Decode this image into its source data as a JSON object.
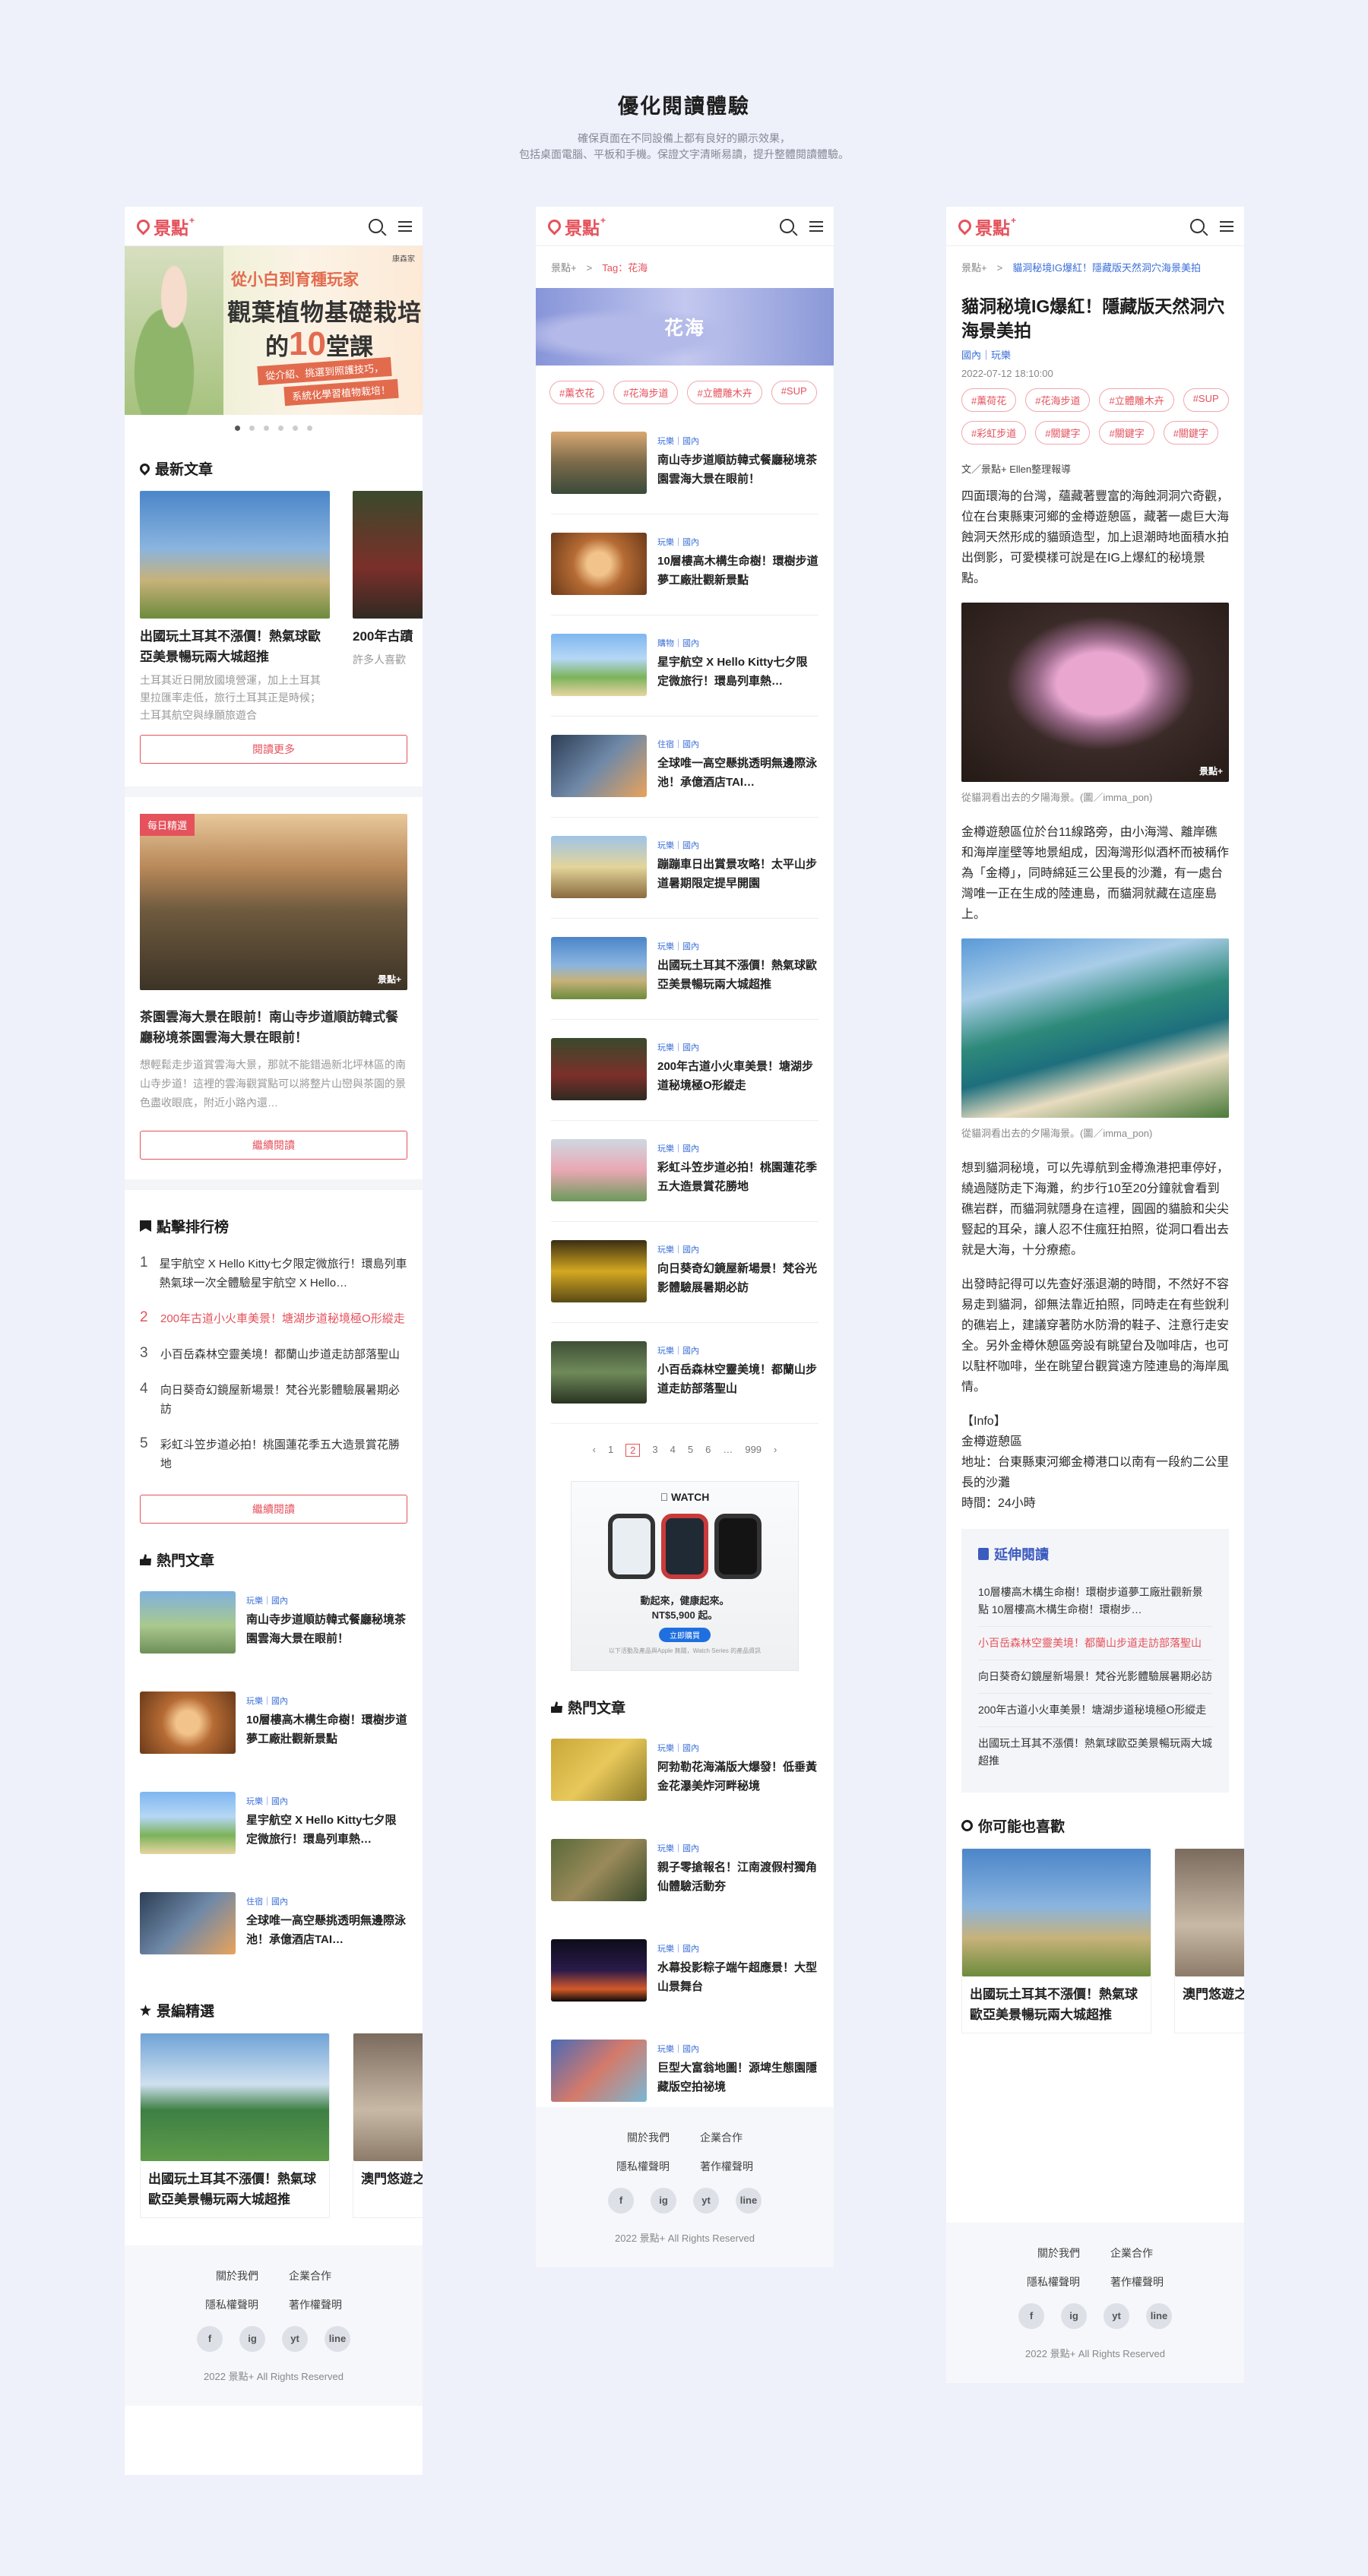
{
  "hero": {
    "title": "優化閱讀體驗",
    "subtitle_1": "確保頁面在不同設備上都有良好的顯示效果，",
    "subtitle_2": "包括桌面電腦、平板和手機。保證文字清晰易讀，提升整體閱讀體驗。"
  },
  "brand": {
    "logo": "景點",
    "logo_plus": "+",
    "accent": "#e5525c",
    "link": "#3b6fd8",
    "watermark": "景點+"
  },
  "icons": {
    "search": "search-icon",
    "menu": "menu-icon"
  },
  "home": {
    "banner": {
      "tag": "康森家",
      "line1": "從小白到育種玩家",
      "line2": "觀葉植物基礎栽培",
      "line3_a": "的",
      "line3_num": "10",
      "line3_b": "堂課",
      "pill1": "從介紹、挑選到照護技巧，",
      "pill2": "系統化學習植物栽培！"
    },
    "latest": {
      "title": "最新文章",
      "cards": [
        {
          "title": "出國玩土耳其不漲價！熱氣球歐亞美景暢玩兩大城超推",
          "desc": "土耳其近日開放國境營運，加上土耳其里拉匯率走低，旅行土耳其正是時候；土耳其航空與綠願旅遊合"
        },
        {
          "title": "200年古蹟",
          "desc": "許多人喜歡"
        }
      ],
      "more": "閱讀更多"
    },
    "feature": {
      "badge": "每日精選",
      "title": "茶園雲海大景在眼前！南山寺步道順訪韓式餐廳秘境茶園雲海大景在眼前！",
      "desc": "想輕鬆走步道賞雲海大景，那就不能錯過新北坪林區的南山寺步道！這裡的雲海觀賞點可以將整片山巒與茶園的景色盡收眼底，附近小路內還…",
      "btn": "繼續閱讀"
    },
    "ranking": {
      "title": "點擊排行榜",
      "items": [
        {
          "n": "1",
          "text": "星宇航空 X Hello Kitty七夕限定微旅行！環島列車熱氣球一次全體驗星宇航空 X Hello…"
        },
        {
          "n": "2",
          "text": "200年古道小火車美景！塘湖步道秘境極O形縱走"
        },
        {
          "n": "3",
          "text": "小百岳森林空靈美境！都蘭山步道走訪部落聖山"
        },
        {
          "n": "4",
          "text": "向日葵奇幻鏡屋新場景！梵谷光影體驗展暑期必訪"
        },
        {
          "n": "5",
          "text": "彩虹斗笠步道必拍！桃園蓮花季五大造景賞花勝地"
        }
      ],
      "btn": "繼續閱讀"
    },
    "hot": {
      "title": "熱門文章",
      "items": [
        {
          "tag": "玩樂｜國內",
          "title": "南山寺步道順訪韓式餐廳秘境茶園雲海大景在眼前！"
        },
        {
          "tag": "玩樂｜國內",
          "title": "10層樓高木構生命樹！環樹步道夢工廠壯觀新景點"
        },
        {
          "tag": "玩樂｜國內",
          "title": "星宇航空 X Hello Kitty七夕限定微旅行！環島列車熱…"
        },
        {
          "tag": "住宿｜國內",
          "title": "全球唯一高空懸挑透明無邊際泳池！承億酒店TAI…"
        }
      ]
    },
    "editor": {
      "title": "景編精選",
      "cards": [
        {
          "title": "出國玩土耳其不漲價！熱氣球歐亞美景暢玩兩大城超推"
        },
        {
          "title": "澳門悠遊之旅"
        }
      ]
    }
  },
  "footer": {
    "about": "關於我們",
    "biz": "企業合作",
    "privacy": "隱私權聲明",
    "copyright_note": "著作權聲明",
    "social": [
      "f",
      "ig",
      "yt",
      "line"
    ],
    "copy": "2022 景點+ All Rights Reserved"
  },
  "tagpage": {
    "crumb_home": "景點+",
    "crumb_sep": ">",
    "crumb_tag": "Tag：花海",
    "topic": "花海",
    "tags": [
      "#薰衣花",
      "#花海步道",
      "#立體雕木卉",
      "#SUP"
    ],
    "items": [
      {
        "tag": "玩樂｜國內",
        "title": "南山寺步道順訪韓式餐廳秘境茶園雲海大景在眼前！"
      },
      {
        "tag": "玩樂｜國內",
        "title": "10層樓高木構生命樹！環樹步道夢工廠壯觀新景點"
      },
      {
        "tag": "購物｜國內",
        "title": "星宇航空 X Hello Kitty七夕限定微旅行！環島列車熱…"
      },
      {
        "tag": "住宿｜國內",
        "title": "全球唯一高空懸挑透明無邊際泳池！承億酒店TAI…"
      },
      {
        "tag": "玩樂｜國內",
        "title": "蹦蹦車日出賞景攻略！太平山步道暑期限定提早開園"
      },
      {
        "tag": "玩樂｜國內",
        "title": "出國玩土耳其不漲價！熱氣球歐亞美景暢玩兩大城超推"
      },
      {
        "tag": "玩樂｜國內",
        "title": "200年古道小火車美景！塘湖步道秘境極O形縱走"
      },
      {
        "tag": "玩樂｜國內",
        "title": "彩虹斗笠步道必拍！桃園蓮花季五大造景賞花勝地"
      },
      {
        "tag": "玩樂｜國內",
        "title": "向日葵奇幻鏡屋新場景！梵谷光影體驗展暑期必訪"
      },
      {
        "tag": "玩樂｜國內",
        "title": "小百岳森林空靈美境！都蘭山步道走訪部落聖山"
      }
    ],
    "pager": [
      "‹",
      "1",
      "2",
      "3",
      "4",
      "5",
      "6",
      "…",
      "999",
      "›"
    ],
    "pager_current": "2",
    "ad": {
      "brand": "WATCH",
      "line1": "動起來，健康起來。",
      "line2": "NT$5,900 起。",
      "cta": "立即購買",
      "fine": "以下活動及產品與Apple 無關，Watch Series 的產品資訊"
    },
    "hot": {
      "title": "熱門文章",
      "items": [
        {
          "tag": "玩樂｜國內",
          "title": "阿勃勒花海滿版大爆發！低垂黃金花瀑美炸河畔秘境"
        },
        {
          "tag": "玩樂｜國內",
          "title": "親子零搶報名！江南渡假村獨角仙體驗活動夯"
        },
        {
          "tag": "玩樂｜國內",
          "title": "水幕投影粽子端午超應景！大型山景舞台"
        },
        {
          "tag": "玩樂｜國內",
          "title": "巨型大富翁地圖！源埤生態園隱藏版空拍祕境"
        }
      ]
    }
  },
  "article": {
    "crumb_home": "景點+",
    "crumb_sep": ">",
    "crumb_title": "貓洞秘境IG爆紅！隱藏版天然洞穴海景美拍",
    "title": "貓洞秘境IG爆紅！隱藏版天然洞穴海景美拍",
    "cat": "國內｜玩樂",
    "date": "2022-07-12 18:10:00",
    "tags": [
      "#薰荷花",
      "#花海步道",
      "#立體雕木卉",
      "#SUP",
      "#彩虹步道",
      "#關鍵字",
      "#關鍵字",
      "#關鍵字"
    ],
    "author": "文／景點+ Ellen整理報導",
    "p1": "四面環海的台灣，蘊藏著豐富的海蝕洞洞穴奇觀，位在台東縣東河鄉的金樽遊憩區，藏著一處巨大海蝕洞天然形成的貓頭造型，加上退潮時地面積水拍出倒影，可愛模樣可說是在IG上爆紅的秘境景點。",
    "cap1": "從貓洞看出去的夕陽海景。(圖／imma_pon)",
    "p2": "金樽遊憩區位於台11線路旁，由小海灣、離岸礁和海岸崖壁等地景組成，因海灣形似酒杯而被稱作為「金樽」，同時綿延三公里長的沙灘，有一處台灣唯一正在生成的陸連島，而貓洞就藏在這座島上。",
    "cap2": "從貓洞看出去的夕陽海景。(圖／imma_pon)",
    "p3": "想到貓洞秘境，可以先導航到金樽漁港把車停好，繞過隧防走下海灘，約步行10至20分鐘就會看到礁岩群，而貓洞就隱身在這裡，圓圓的貓臉和尖尖豎起的耳朵，讓人忍不住瘋狂拍照，從洞口看出去就是大海，十分療癒。",
    "p4": "出發時記得可以先查好漲退潮的時間，不然好不容易走到貓洞，卻無法靠近拍照，同時走在有些銳利的礁岩上，建議穿著防水防滑的鞋子、注意行走安全。另外金樽休憩區旁設有眺望台及咖啡店，也可以駐杯咖啡，坐在眺望台觀賞遠方陸連島的海岸風情。",
    "info_h": "【Info】",
    "info_1": "金樽遊憩區",
    "info_2": "地址：台東縣東河鄉金樽港口以南有一段約二公里長的沙灘",
    "info_3": "時間：24小時",
    "ext": {
      "title": "延伸閱讀",
      "items": [
        "10層樓高木構生命樹！環樹步道夢工廠壯觀新景點 10層樓高木構生命樹！環樹步…",
        "小百岳森林空靈美境！都蘭山步道走訪部落聖山",
        "向日葵奇幻鏡屋新場景！梵谷光影體驗展暑期必訪",
        "200年古道小火車美景！塘湖步道秘境極O形縱走",
        "出國玩土耳其不漲價！熱氣球歐亞美景暢玩兩大城超推"
      ]
    },
    "like": {
      "title": "你可能也喜歡",
      "cards": [
        {
          "title": "出國玩土耳其不漲價！熱氣球歐亞美景暢玩兩大城超推"
        },
        {
          "title": "澳門悠遊之旅"
        }
      ]
    }
  }
}
